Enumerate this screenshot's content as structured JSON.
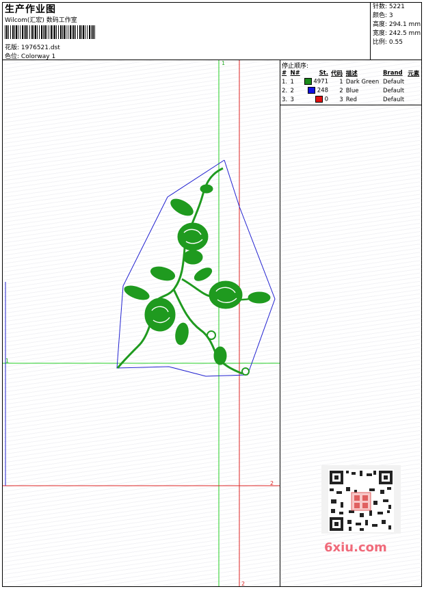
{
  "header": {
    "title": "生产作业图",
    "company": "Wilcom(汇宏) 数码工作室",
    "pattern_label": "花版:",
    "pattern_value": "1976521.dst",
    "color_label": "色位:",
    "color_value": "Colorway 1"
  },
  "stats": [
    {
      "label": "针数:",
      "value": "5221"
    },
    {
      "label": "颜色:",
      "value": "3"
    },
    {
      "label": "高度:",
      "value": "294.1 mm"
    },
    {
      "label": "宽度:",
      "value": "242.5 mm"
    },
    {
      "label": "比例:",
      "value": "0.55"
    }
  ],
  "stop_sequence": {
    "title": "停止顺序:",
    "columns": [
      "#",
      "N#",
      "St.",
      "代码",
      "描述",
      "Brand",
      "元素"
    ],
    "rows": [
      {
        "idx": "1.",
        "n": "1",
        "color": "#1a8a1a",
        "st": "4971",
        "code": "1",
        "desc": "Dark Green",
        "brand": "Default"
      },
      {
        "idx": "2.",
        "n": "2",
        "color": "#1010e0",
        "st": "248",
        "code": "2",
        "desc": "Blue",
        "brand": "Default"
      },
      {
        "idx": "3.",
        "n": "3",
        "color": "#e01010",
        "st": "0",
        "code": "3",
        "desc": "Red",
        "brand": "Default"
      }
    ]
  },
  "guides": {
    "green_label_top": "1",
    "green_label_left": "1",
    "red_label_right": "2",
    "red_label_bottom": "2"
  },
  "watermark": "6xiu.com",
  "colors": {
    "design": "#1f9a1f",
    "outline": "#2020d0",
    "guide_green": "#22cc22",
    "guide_red": "#dd2222"
  }
}
